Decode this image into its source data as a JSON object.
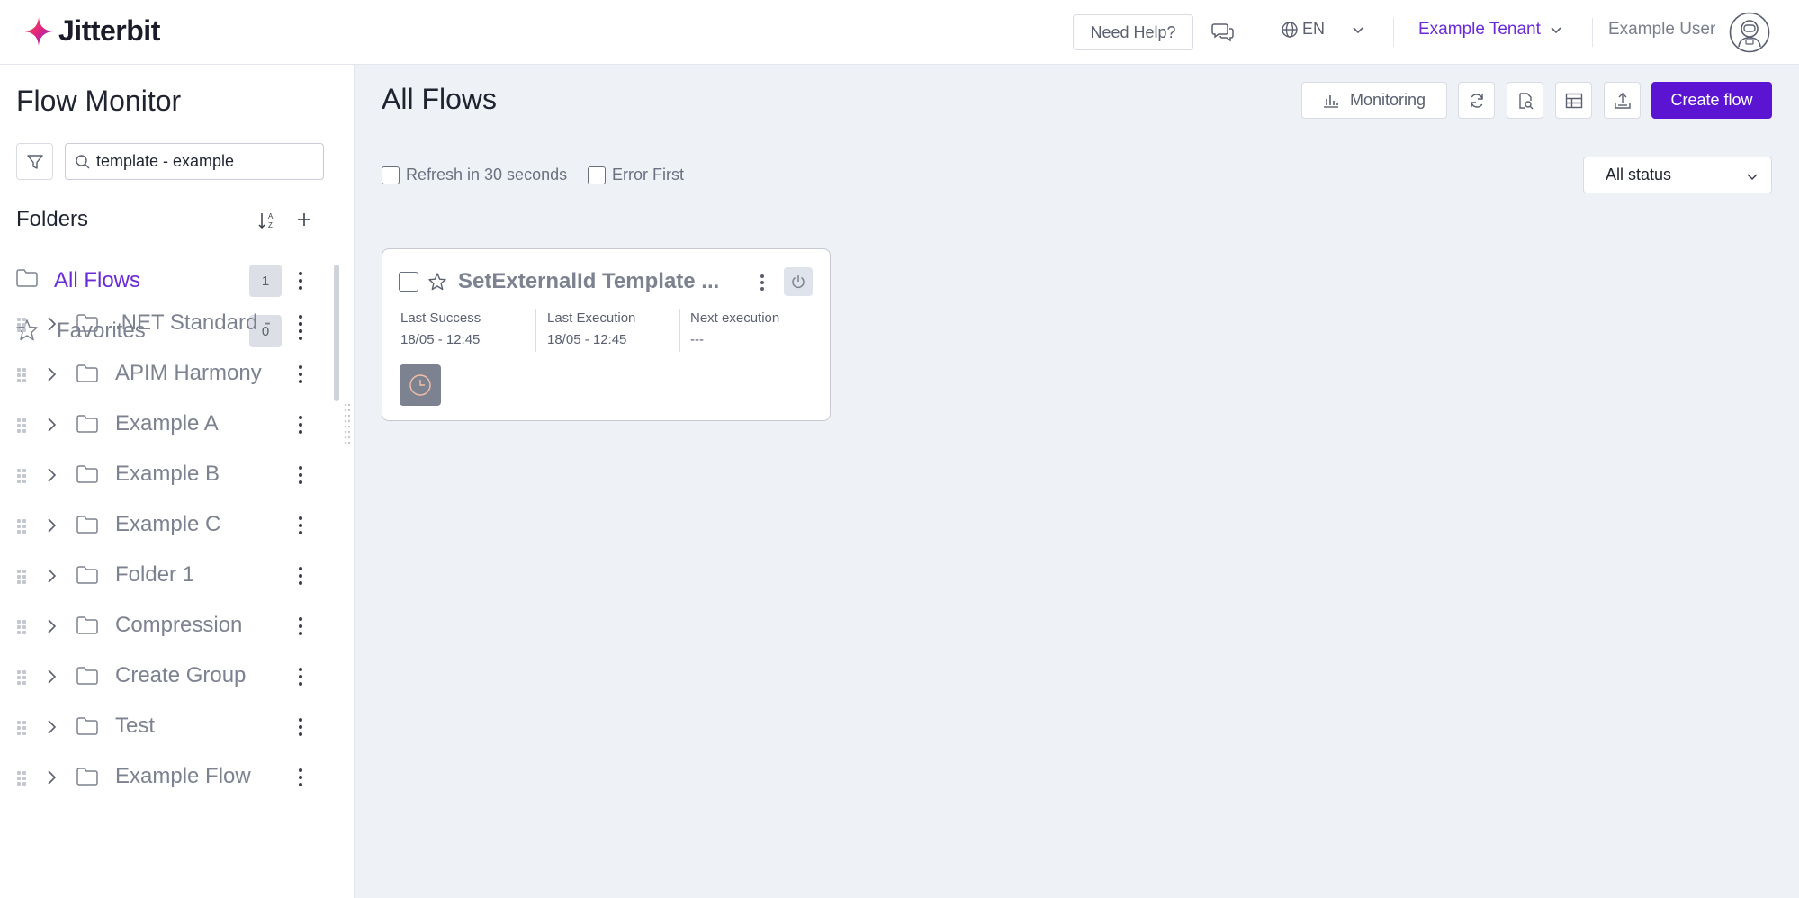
{
  "brand": {
    "name": "Jitterbit"
  },
  "header": {
    "help_label": "Need Help?",
    "language": "EN",
    "tenant": "Example Tenant",
    "user": "Example User"
  },
  "sidebar": {
    "title": "Flow Monitor",
    "search_value": "template - example",
    "folders_label": "Folders",
    "special": [
      {
        "label": "All Flows",
        "count": "1",
        "icon": "folder-icon"
      },
      {
        "label": "Favorites",
        "count": "0",
        "icon": "star-icon"
      }
    ],
    "folders": [
      ".NET Standard -",
      "APIM Harmony",
      "Example A",
      "Example B",
      "Example C",
      "Folder 1",
      "Compression",
      "Create Group",
      "Test",
      "Example Flow"
    ]
  },
  "main": {
    "title": "All Flows",
    "monitoring_label": "Monitoring",
    "create_label": "Create flow",
    "refresh_label": "Refresh in 30 seconds",
    "error_first_label": "Error First",
    "status_select": "All status"
  },
  "flow_card": {
    "title": "SetExternalId Template ...",
    "last_success_label": "Last Success",
    "last_success_value": "18/05 - 12:45",
    "last_execution_label": "Last Execution",
    "last_execution_value": "18/05 - 12:45",
    "next_execution_label": "Next execution",
    "next_execution_value": "---"
  },
  "colors": {
    "accent": "#5b14d1",
    "tenant": "#6b2bd6",
    "background": "#eef1f6"
  }
}
